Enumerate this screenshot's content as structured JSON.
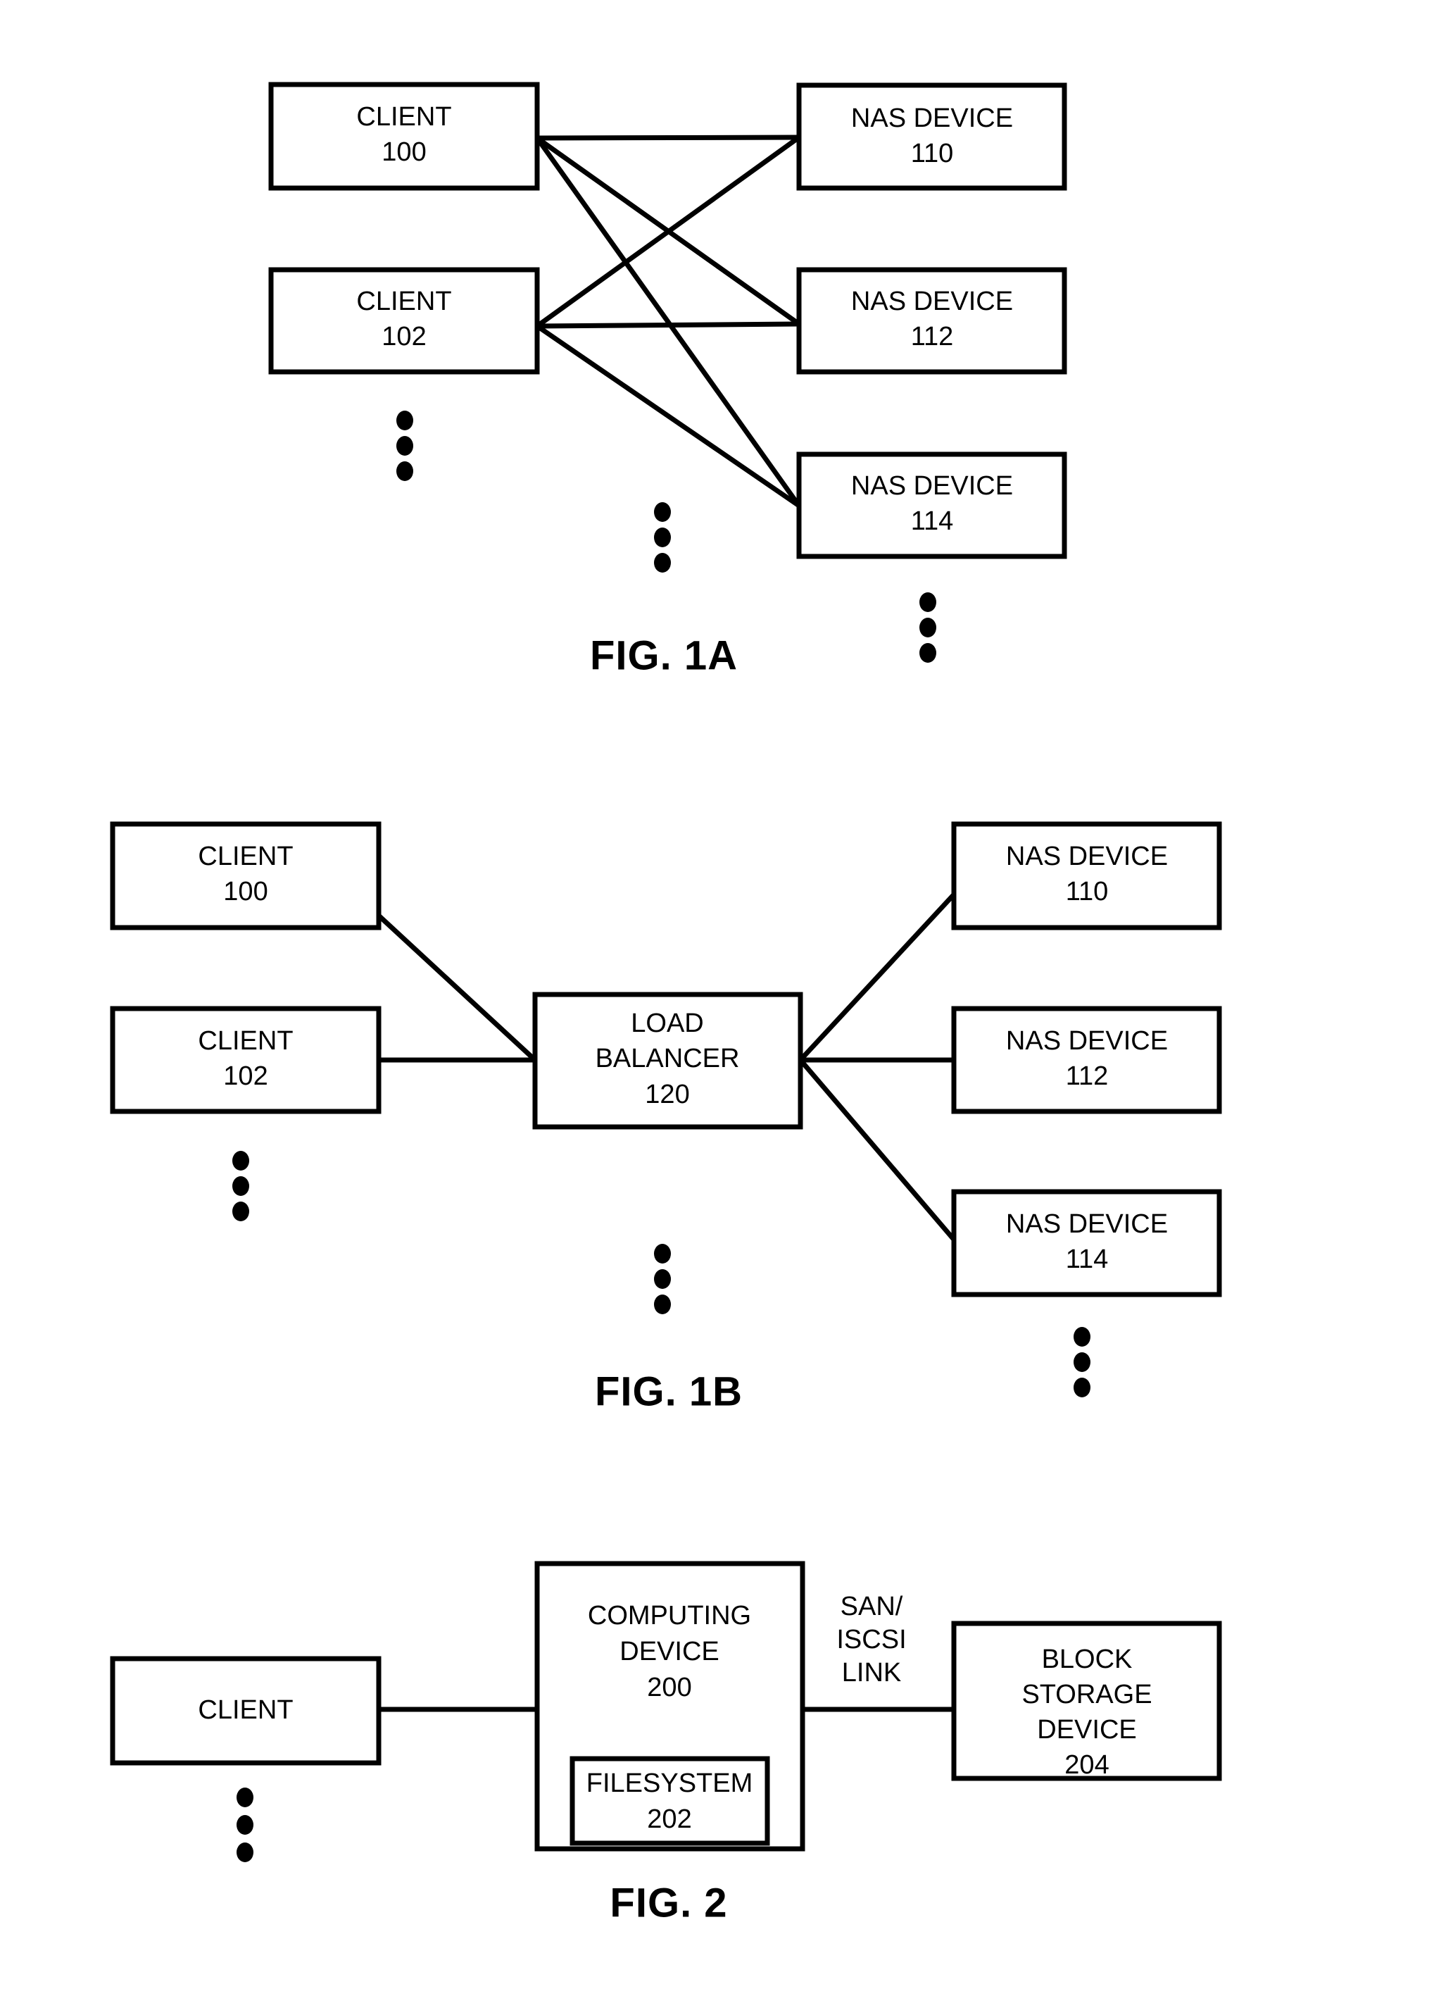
{
  "figures": [
    {
      "id": "fig-1a",
      "caption": "FIG. 1A",
      "nodes": {
        "client_100_line1": "CLIENT",
        "client_100_line2": "100",
        "client_102_line1": "CLIENT",
        "client_102_line2": "102",
        "nas_110_line1": "NAS DEVICE",
        "nas_110_line2": "110",
        "nas_112_line1": "NAS DEVICE",
        "nas_112_line2": "112",
        "nas_114_line1": "NAS DEVICE",
        "nas_114_line2": "114"
      }
    },
    {
      "id": "fig-1b",
      "caption": "FIG. 1B",
      "nodes": {
        "client_100_line1": "CLIENT",
        "client_100_line2": "100",
        "client_102_line1": "CLIENT",
        "client_102_line2": "102",
        "load_balancer_line1": "LOAD",
        "load_balancer_line2": "BALANCER",
        "load_balancer_line3": "120",
        "nas_110_line1": "NAS DEVICE",
        "nas_110_line2": "110",
        "nas_112_line1": "NAS DEVICE",
        "nas_112_line2": "112",
        "nas_114_line1": "NAS DEVICE",
        "nas_114_line2": "114"
      }
    },
    {
      "id": "fig-2",
      "caption": "FIG. 2",
      "nodes": {
        "client_line1": "CLIENT",
        "computing_device_line1": "COMPUTING",
        "computing_device_line2": "DEVICE",
        "computing_device_line3": "200",
        "filesystem_line1": "FILESYSTEM",
        "filesystem_line2": "202",
        "block_storage_line1": "BLOCK",
        "block_storage_line2": "STORAGE",
        "block_storage_line3": "DEVICE",
        "block_storage_line4": "204"
      },
      "edge_labels": {
        "san_iscsi_line1": "SAN/",
        "san_iscsi_line2": "ISCSI",
        "san_iscsi_line3": "LINK"
      }
    }
  ],
  "colors": {
    "stroke": "#000000",
    "fill": "#ffffff",
    "background": "#ffffff"
  }
}
